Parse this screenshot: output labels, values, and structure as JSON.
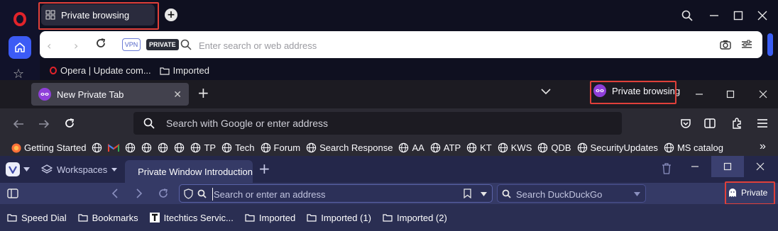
{
  "opera": {
    "tab_label": "Private browsing",
    "vpn_badge": "VPN",
    "private_badge": "PRIVATE",
    "address_placeholder": "Enter search or web address",
    "bookmarks": [
      {
        "label": "Opera | Update com..."
      },
      {
        "label": "Imported"
      }
    ]
  },
  "firefox": {
    "tab_label": "New Private Tab",
    "private_indicator": "Private browsing",
    "address_placeholder": "Search with Google or enter address",
    "bookmarks": [
      {
        "label": "Getting Started"
      },
      {
        "label": "TP"
      },
      {
        "label": "Tech"
      },
      {
        "label": "Forum"
      },
      {
        "label": "Search Response"
      },
      {
        "label": "AA"
      },
      {
        "label": "ATP"
      },
      {
        "label": "KT"
      },
      {
        "label": "KWS"
      },
      {
        "label": "QDB"
      },
      {
        "label": "SecurityUpdates"
      },
      {
        "label": "MS catalog"
      }
    ],
    "more_bookmarks": "»"
  },
  "vivaldi": {
    "workspaces_label": "Workspaces",
    "tab_label": "Private Window Introduction",
    "address_placeholder": "Search or enter an address",
    "search_placeholder": "Search DuckDuckGo",
    "private_button": "Private",
    "bookmarks": [
      {
        "label": "Speed Dial"
      },
      {
        "label": "Bookmarks"
      },
      {
        "label": "Itechtics Servic..."
      },
      {
        "label": "Imported"
      },
      {
        "label": "Imported (1)"
      },
      {
        "label": "Imported (2)"
      }
    ]
  },
  "colors": {
    "highlight": "#e0403a",
    "opera_accent": "#3c5bf5",
    "firefox_private": "#8f3fd9"
  }
}
